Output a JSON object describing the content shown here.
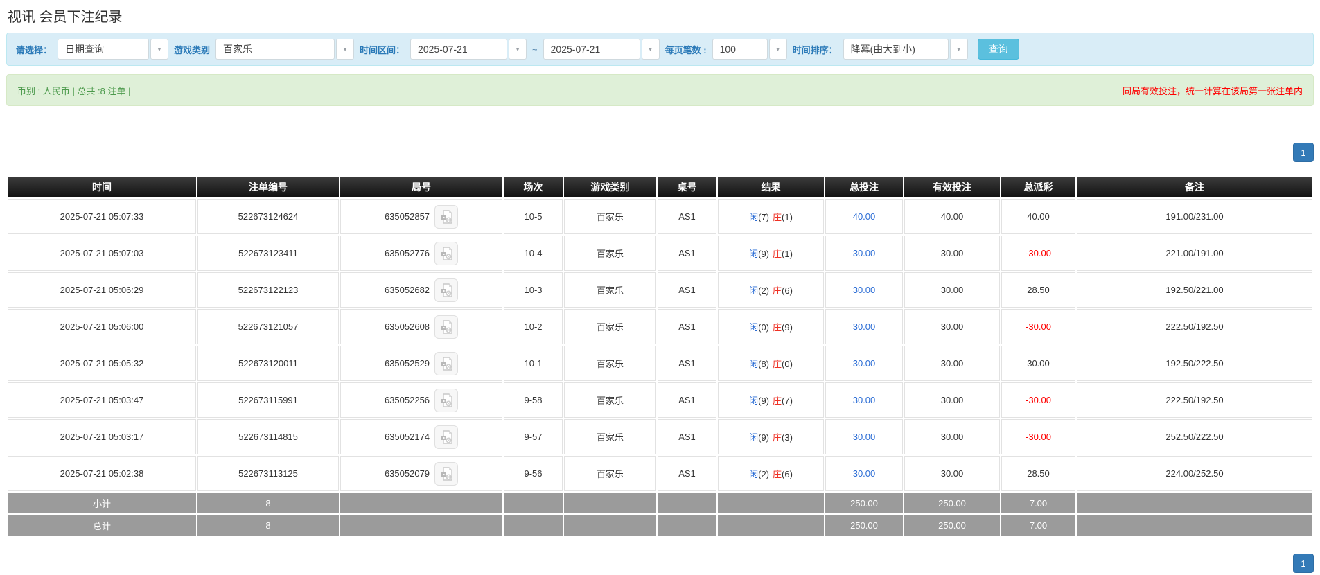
{
  "page": {
    "title": "视讯 会员下注纪录"
  },
  "colors": {
    "filter_bg": "#d9edf7",
    "filter_label": "#2b7ab8",
    "search_button_bg": "#5bc0de",
    "success_bg": "#dff0d8",
    "success_text": "#4c9a4c",
    "warning_red": "#ff0000",
    "header_bg": "#1a1a1a",
    "pager_blue": "#337ab7",
    "link_blue": "#2a6cd5",
    "player_blue": "#2a6cd5",
    "banker_red": "#ee3124",
    "negative_red": "#ff0000",
    "sum_row_bg": "#9b9b9b"
  },
  "icons": {
    "dropdown_arrow": "▼",
    "video_replay": "video-replay"
  },
  "filter": {
    "select_label": "请选择：",
    "select_value": "日期查询",
    "game_label": "游戏类别",
    "game_value": "百家乐",
    "range_label": "时间区间：",
    "date_from": "2025-07-21",
    "tilde": "~",
    "date_to": "2025-07-21",
    "page_size_label": "每页笔数 :",
    "page_size_value": "100",
    "sort_label": "时间排序：",
    "sort_value": "降冪(由大到小)",
    "search_button": "查询"
  },
  "summary": {
    "left": "币别 : 人民币 | 总共 :8 注单 |",
    "right": "同局有效投注，统一计算在该局第一张注单内"
  },
  "pagination": {
    "page": "1"
  },
  "table": {
    "headers": [
      "时间",
      "注单编号",
      "局号",
      "场次",
      "游戏类别",
      "桌号",
      "结果",
      "总投注",
      "有效投注",
      "总派彩",
      "备注"
    ],
    "rows": [
      {
        "time": "2025-07-21 05:07:33",
        "bet_id": "522673124624",
        "round_id": "635052857",
        "session": "10-5",
        "game": "百家乐",
        "table_no": "AS1",
        "res_player_label": "闲",
        "res_player_val": "(7)",
        "res_banker_label": "庄",
        "res_banker_val": "(1)",
        "total_bet": "40.00",
        "valid_bet": "40.00",
        "payout": "40.00",
        "payout_neg": false,
        "remark": "191.00/231.00"
      },
      {
        "time": "2025-07-21 05:07:03",
        "bet_id": "522673123411",
        "round_id": "635052776",
        "session": "10-4",
        "game": "百家乐",
        "table_no": "AS1",
        "res_player_label": "闲",
        "res_player_val": "(9)",
        "res_banker_label": "庄",
        "res_banker_val": "(1)",
        "total_bet": "30.00",
        "valid_bet": "30.00",
        "payout": "-30.00",
        "payout_neg": true,
        "remark": "221.00/191.00"
      },
      {
        "time": "2025-07-21 05:06:29",
        "bet_id": "522673122123",
        "round_id": "635052682",
        "session": "10-3",
        "game": "百家乐",
        "table_no": "AS1",
        "res_player_label": "闲",
        "res_player_val": "(2)",
        "res_banker_label": "庄",
        "res_banker_val": "(6)",
        "total_bet": "30.00",
        "valid_bet": "30.00",
        "payout": "28.50",
        "payout_neg": false,
        "remark": "192.50/221.00"
      },
      {
        "time": "2025-07-21 05:06:00",
        "bet_id": "522673121057",
        "round_id": "635052608",
        "session": "10-2",
        "game": "百家乐",
        "table_no": "AS1",
        "res_player_label": "闲",
        "res_player_val": "(0)",
        "res_banker_label": "庄",
        "res_banker_val": "(9)",
        "total_bet": "30.00",
        "valid_bet": "30.00",
        "payout": "-30.00",
        "payout_neg": true,
        "remark": "222.50/192.50"
      },
      {
        "time": "2025-07-21 05:05:32",
        "bet_id": "522673120011",
        "round_id": "635052529",
        "session": "10-1",
        "game": "百家乐",
        "table_no": "AS1",
        "res_player_label": "闲",
        "res_player_val": "(8)",
        "res_banker_label": "庄",
        "res_banker_val": "(0)",
        "total_bet": "30.00",
        "valid_bet": "30.00",
        "payout": "30.00",
        "payout_neg": false,
        "remark": "192.50/222.50"
      },
      {
        "time": "2025-07-21 05:03:47",
        "bet_id": "522673115991",
        "round_id": "635052256",
        "session": "9-58",
        "game": "百家乐",
        "table_no": "AS1",
        "res_player_label": "闲",
        "res_player_val": "(9)",
        "res_banker_label": "庄",
        "res_banker_val": "(7)",
        "total_bet": "30.00",
        "valid_bet": "30.00",
        "payout": "-30.00",
        "payout_neg": true,
        "remark": "222.50/192.50"
      },
      {
        "time": "2025-07-21 05:03:17",
        "bet_id": "522673114815",
        "round_id": "635052174",
        "session": "9-57",
        "game": "百家乐",
        "table_no": "AS1",
        "res_player_label": "闲",
        "res_player_val": "(9)",
        "res_banker_label": "庄",
        "res_banker_val": "(3)",
        "total_bet": "30.00",
        "valid_bet": "30.00",
        "payout": "-30.00",
        "payout_neg": true,
        "remark": "252.50/222.50"
      },
      {
        "time": "2025-07-21 05:02:38",
        "bet_id": "522673113125",
        "round_id": "635052079",
        "session": "9-56",
        "game": "百家乐",
        "table_no": "AS1",
        "res_player_label": "闲",
        "res_player_val": "(2)",
        "res_banker_label": "庄",
        "res_banker_val": "(6)",
        "total_bet": "30.00",
        "valid_bet": "30.00",
        "payout": "28.50",
        "payout_neg": false,
        "remark": "224.00/252.50"
      }
    ],
    "subtotal": {
      "label": "小计",
      "count": "8",
      "total_bet": "250.00",
      "valid_bet": "250.00",
      "payout": "7.00"
    },
    "total": {
      "label": "总计",
      "count": "8",
      "total_bet": "250.00",
      "valid_bet": "250.00",
      "payout": "7.00"
    }
  }
}
